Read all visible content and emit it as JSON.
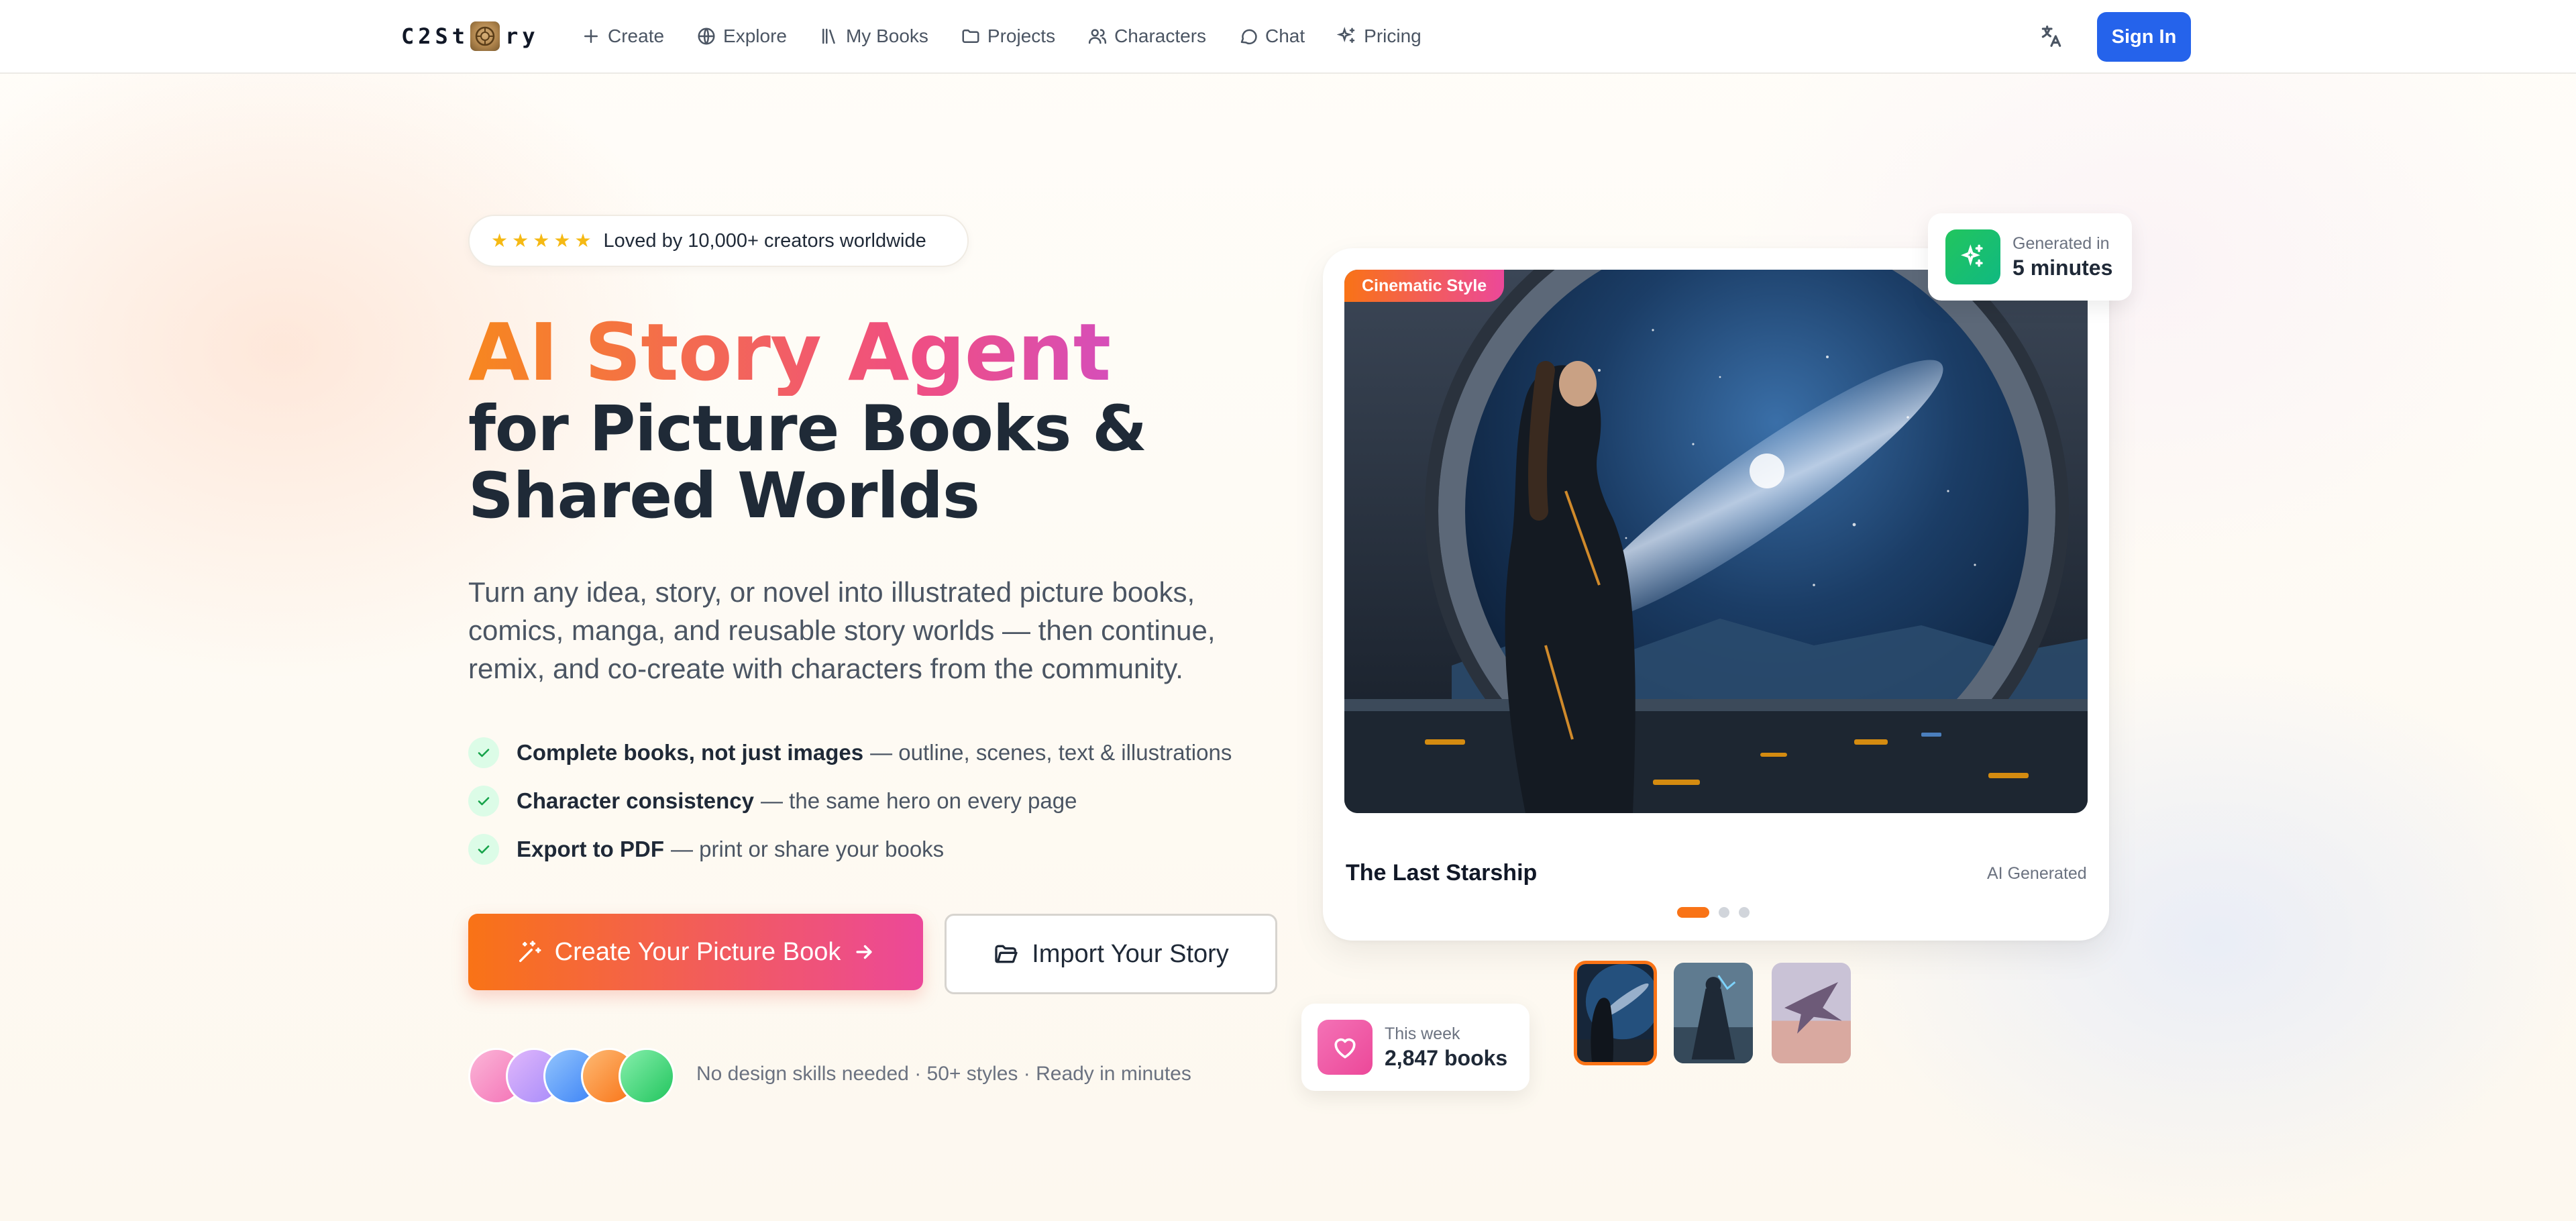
{
  "header": {
    "logo_text_left": "C2St",
    "logo_text_right": "ry",
    "nav": [
      {
        "label": "Create",
        "icon": "plus-icon"
      },
      {
        "label": "Explore",
        "icon": "globe-icon"
      },
      {
        "label": "My Books",
        "icon": "library-icon"
      },
      {
        "label": "Projects",
        "icon": "folder-icon"
      },
      {
        "label": "Characters",
        "icon": "users-icon"
      },
      {
        "label": "Chat",
        "icon": "chat-bubble-icon"
      },
      {
        "label": "Pricing",
        "icon": "sparkles-icon"
      }
    ],
    "language_icon": "translate-icon",
    "sign_in": "Sign In"
  },
  "hero": {
    "rating_text": "Loved by 10,000+ creators worldwide",
    "stars": 5,
    "title_gradient": "AI Story Agent",
    "title_line2": "for Picture Books &",
    "title_line3": "Shared Worlds",
    "description": "Turn any idea, story, or novel into illustrated picture books, comics, manga, and reusable story worlds — then continue, remix, and co-create with characters from the community.",
    "features": [
      {
        "bold": "Complete books, not just images",
        "rest": "— outline, scenes, text & illustrations"
      },
      {
        "bold": "Character consistency",
        "rest": "— the same hero on every page"
      },
      {
        "bold": "Export to PDF",
        "rest": "— print or share your books"
      }
    ],
    "cta_primary": "Create Your Picture Book",
    "cta_secondary": "Import Your Story",
    "social_proof": "No design skills needed · 50+ styles · Ready in minutes",
    "avatar_colors": [
      "#f9a8d4",
      "#c4a1f5",
      "#7aa7f5",
      "#fb9f4f",
      "#5fd37a"
    ]
  },
  "showcase": {
    "style_badge": "Cinematic Style",
    "book_title": "The Last Starship",
    "book_tag": "AI Generated",
    "slides_total": 3,
    "active_slide": 1,
    "generated_label": "Generated in",
    "generated_value": "5 minutes",
    "week_label": "This week",
    "week_value": "2,847 books",
    "accent": "#f97316",
    "brand_blue": "#2563eb"
  }
}
